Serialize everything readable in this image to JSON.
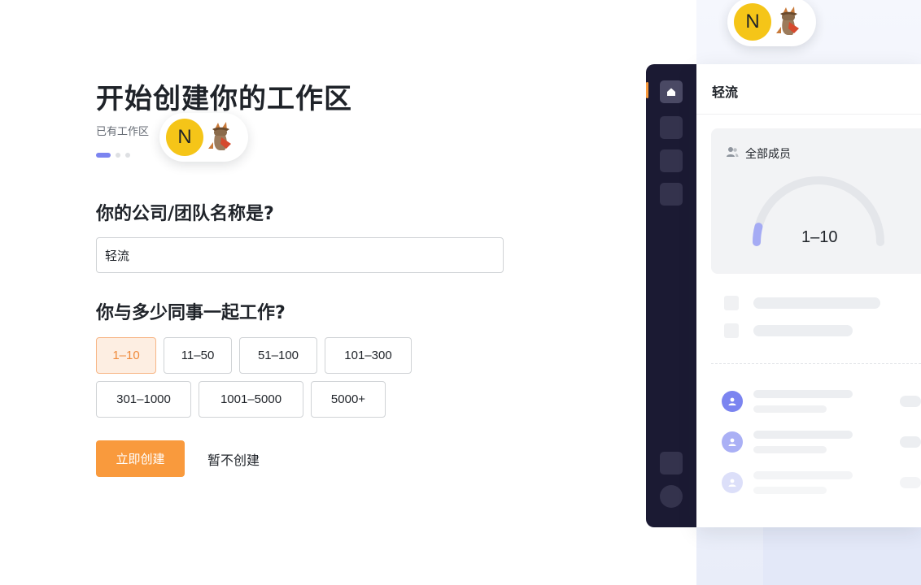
{
  "form": {
    "title": "开始创建你的工作区",
    "subtitle": "已有工作区",
    "step": {
      "current": 1,
      "total": 3
    },
    "company_question": "你的公司/团队名称是?",
    "company_value": "轻流",
    "size_question": "你与多少同事一起工作?",
    "size_options": [
      "1–10",
      "11–50",
      "51–100",
      "101–300",
      "301–1000",
      "1001–5000",
      "5000+"
    ],
    "selected_size": "1–10",
    "create_label": "立即创建",
    "skip_label": "暂不创建"
  },
  "avatar_letter": "N",
  "preview": {
    "workspace_name": "轻流",
    "members_label": "全部成员",
    "member_range": "1–10",
    "gauge_fraction": 0.08
  },
  "colors": {
    "accent": "#f99a3d",
    "step_active": "#7b84f0",
    "sidebar": "#1b1a33"
  }
}
